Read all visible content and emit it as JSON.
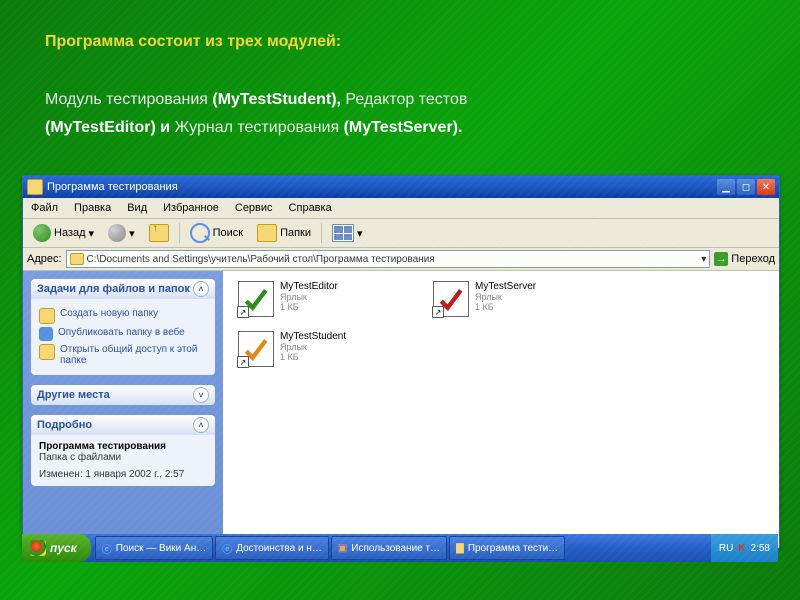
{
  "heading": {
    "line1_bold": "Программа состоит из трех модулей:",
    "line2_pre": "Модуль тестирования ",
    "line2_mod1": "(MyTestStudent),",
    "line2_mid": " Редактор тестов",
    "line3_mod2": " (MyTestEditor) и ",
    "line3_post": "Журнал тестирования ",
    "line3_mod3": "(MyTestServer)."
  },
  "window": {
    "title": "Программа тестирования",
    "menu": [
      "Файл",
      "Правка",
      "Вид",
      "Избранное",
      "Сервис",
      "Справка"
    ],
    "toolbar": {
      "back": "Назад",
      "search": "Поиск",
      "folders": "Папки"
    },
    "address_label": "Адрес:",
    "address_value": "C:\\Documents and Settings\\учитель\\Рабочий стол\\Программа тестирования",
    "go": "Переход"
  },
  "sidepanel": {
    "tasks_title": "Задачи для файлов и папок",
    "tasks": [
      "Создать новую папку",
      "Опубликовать папку в вебе",
      "Открыть общий доступ к этой папке"
    ],
    "other_title": "Другие места",
    "details_title": "Подробно",
    "details_name": "Программа тестирования",
    "details_type": "Папка с файлами",
    "details_mod": "Изменен: 1 января 2002 г., 2:57"
  },
  "files": [
    {
      "name": "MyTestEditor",
      "type": "Ярлык",
      "size": "1 КБ",
      "accent": "#2a8f1a"
    },
    {
      "name": "MyTestStudent",
      "type": "Ярлык",
      "size": "1 КБ",
      "accent": "#e08a1a"
    },
    {
      "name": "MyTestServer",
      "type": "Ярлык",
      "size": "1 КБ",
      "accent": "#c01a1a"
    }
  ],
  "taskbar": {
    "start": "пуск",
    "items": [
      "Поиск — Вики Ан…",
      "Достоинства и н…",
      "Использование т…",
      "Программа тести…"
    ],
    "lang": "RU",
    "time": "2:58"
  }
}
